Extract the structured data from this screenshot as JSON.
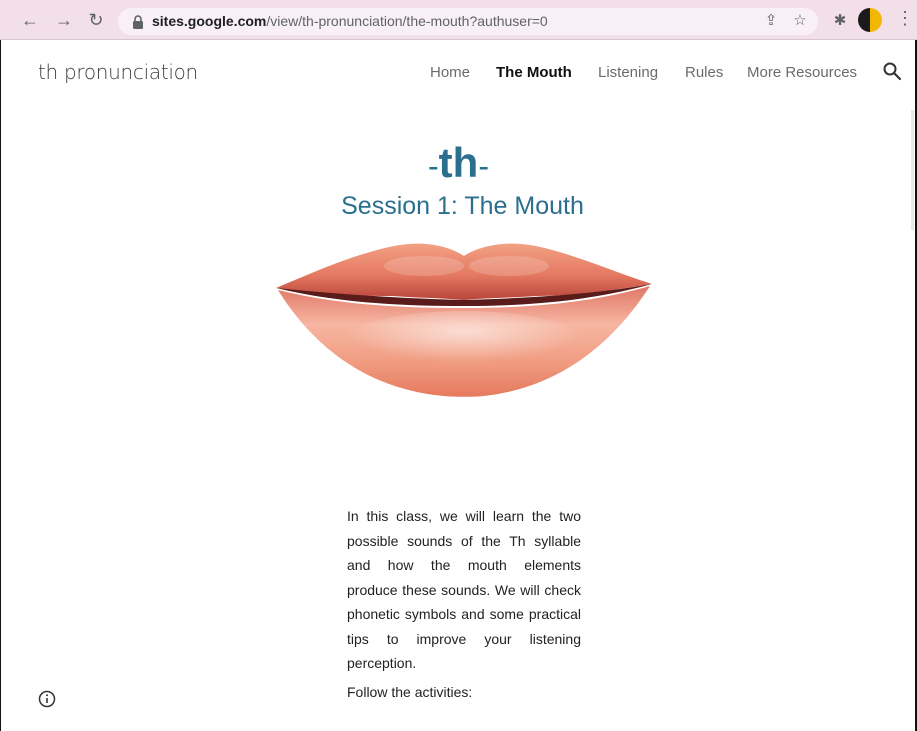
{
  "browser": {
    "url_host": "sites.google.com",
    "url_path": "/view/th-pronunciation/the-mouth?authuser=0",
    "icons": [
      "back-arrow-icon",
      "forward-arrow-icon",
      "reload-icon",
      "lock-icon",
      "share-icon",
      "bookmark-star-icon",
      "extensions-puzzle-icon",
      "profile-avatar",
      "more-menu-icon"
    ],
    "glyphs": {
      "back": "←",
      "forward": "→",
      "reload": "↻",
      "share": "⇪",
      "star": "☆",
      "puzzle": "✱",
      "menu": "⋮"
    }
  },
  "site": {
    "title": "th pronunciation",
    "nav": [
      "Home",
      "The Mouth",
      "Listening",
      "Rules",
      "More Resources"
    ],
    "active_nav": "The Mouth",
    "accent_color": "#2b6f8f"
  },
  "hero": {
    "th_dash_left": "-",
    "th_text": "th",
    "th_dash_right": "-",
    "session_title": "Session 1: The Mouth",
    "image": "lips-illustration"
  },
  "content": {
    "intro": "In this class, we will learn the two possible sounds of the Th syllable and how the mouth elements produce these sounds. We will check phonetic symbols and some practical tips to improve your listening perception.",
    "follow": "Follow the activities:"
  }
}
